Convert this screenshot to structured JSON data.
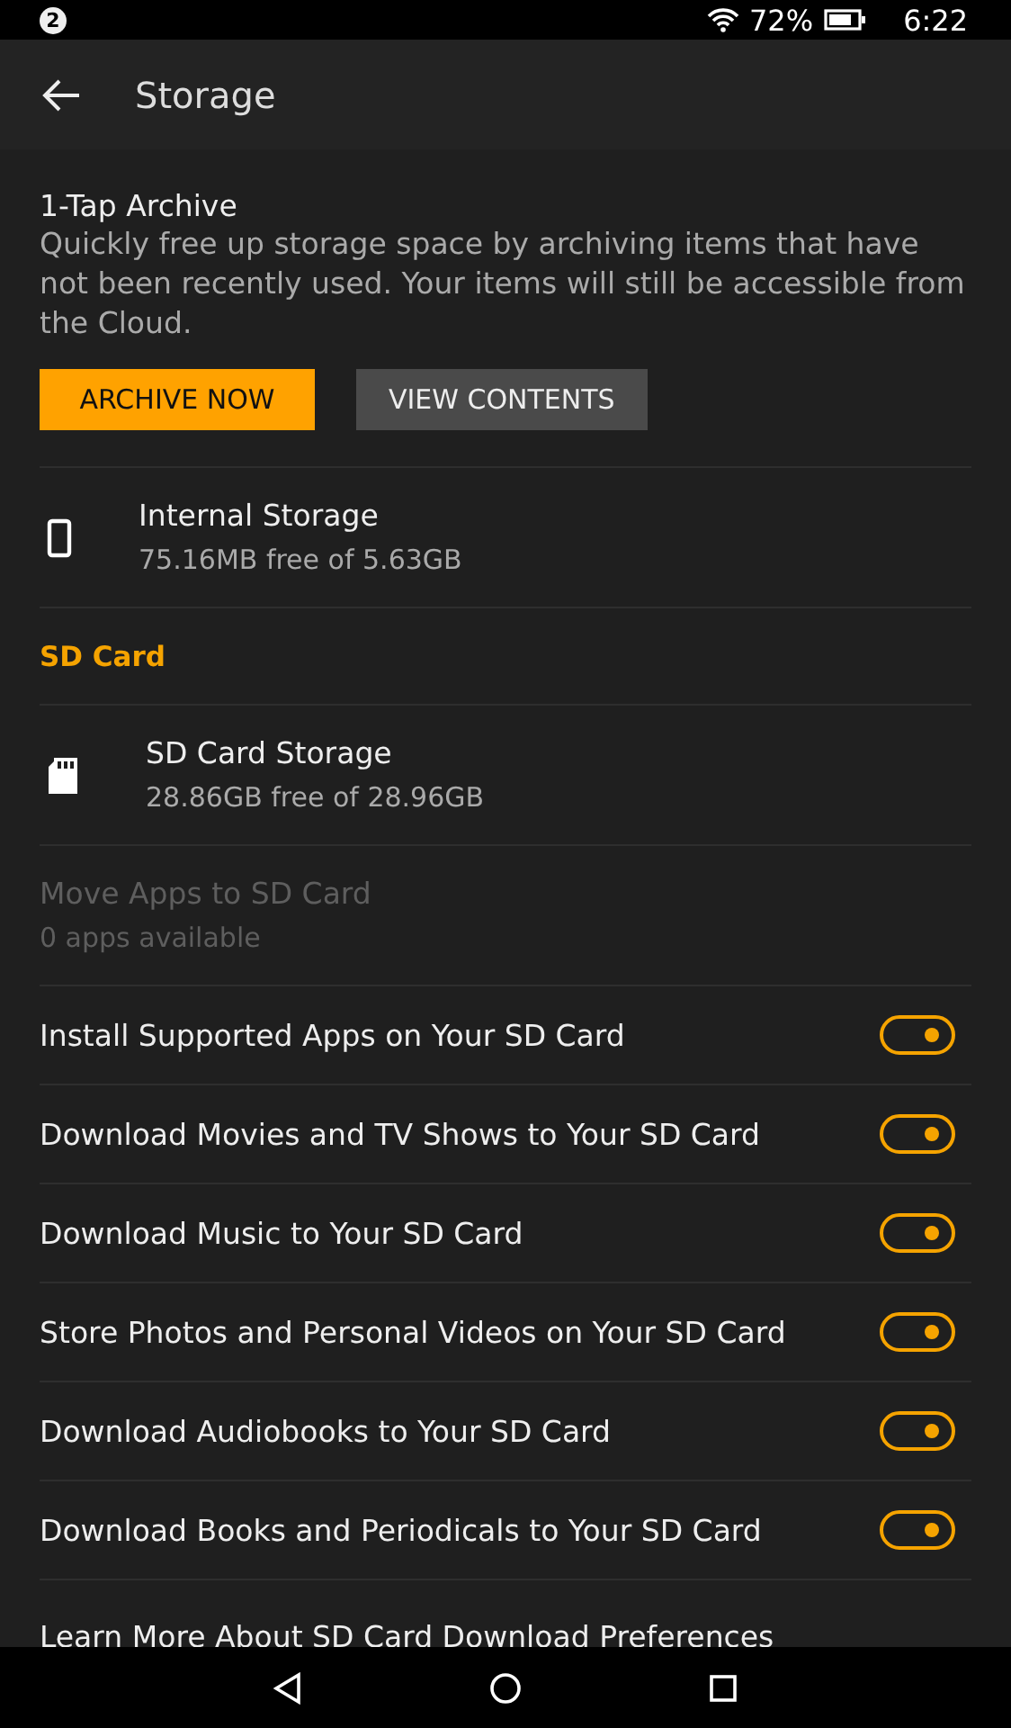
{
  "status_bar": {
    "notification_count": "2",
    "battery": "72%",
    "time": "6:22"
  },
  "app_bar": {
    "title": "Storage"
  },
  "archive": {
    "title": "1-Tap Archive",
    "description": "Quickly free up storage space by archiving items that have not been recently used. Your items will still be accessible from the Cloud.",
    "buttons": [
      {
        "label": "ARCHIVE NOW",
        "kind": "primary"
      },
      {
        "label": "VIEW CONTENTS",
        "kind": "secondary"
      }
    ]
  },
  "internal_storage": {
    "title": "Internal Storage",
    "detail": "75.16MB free of 5.63GB"
  },
  "sd_section": {
    "header": "SD Card",
    "storage": {
      "title": "SD Card Storage",
      "detail": "28.86GB free of 28.96GB"
    },
    "move_apps": {
      "title": "Move Apps to SD Card",
      "detail": "0 apps available",
      "disabled": true
    }
  },
  "toggles": [
    {
      "label": "Install Supported Apps on Your SD Card",
      "on": true
    },
    {
      "label": "Download Movies and TV Shows to Your SD Card",
      "on": true
    },
    {
      "label": "Download Music to Your SD Card",
      "on": true
    },
    {
      "label": "Store Photos and Personal Videos on Your SD Card",
      "on": true
    },
    {
      "label": "Download Audiobooks to Your SD Card",
      "on": true
    },
    {
      "label": "Download Books and Periodicals to Your SD Card",
      "on": true
    }
  ],
  "learn_more": "Learn More About SD Card Download Preferences"
}
